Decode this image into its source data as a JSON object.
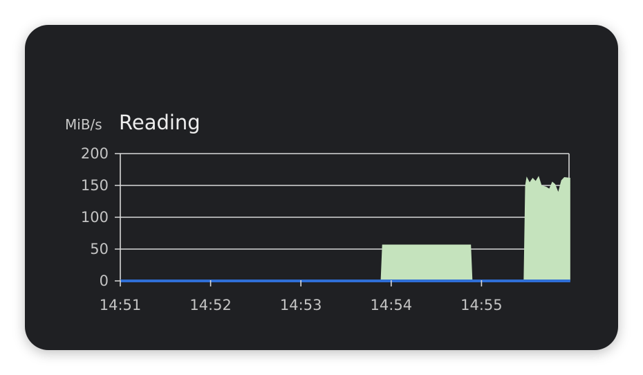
{
  "header": {
    "unit_label": "MiB/s",
    "title": "Reading"
  },
  "colors": {
    "background": "#1f2023",
    "grid": "#d9d9d9",
    "area": "#c5e3bd",
    "baseline": "#2f6fd6",
    "text": "#c4c4c4"
  },
  "chart_data": {
    "type": "area",
    "title": "Reading",
    "ylabel": "MiB/s",
    "ylim": [
      0,
      200
    ],
    "y_ticks": [
      "0",
      "50",
      "100",
      "150",
      "200"
    ],
    "x_ticks": [
      "14:51",
      "14:52",
      "14:53",
      "14:54",
      "14:55"
    ],
    "xlim": [
      "14:51:00",
      "14:55:59"
    ],
    "grid": true,
    "series": [
      {
        "values": [
          {
            "t": "14:51:00",
            "v": 0
          },
          {
            "t": "14:53:53",
            "v": 0
          },
          {
            "t": "14:53:54",
            "v": 57
          },
          {
            "t": "14:54:53",
            "v": 57
          },
          {
            "t": "14:54:54",
            "v": 0
          },
          {
            "t": "14:55:28",
            "v": 0
          },
          {
            "t": "14:55:29",
            "v": 150
          },
          {
            "t": "14:55:30",
            "v": 164
          },
          {
            "t": "14:55:32",
            "v": 155
          },
          {
            "t": "14:55:34",
            "v": 162
          },
          {
            "t": "14:55:36",
            "v": 157
          },
          {
            "t": "14:55:38",
            "v": 165
          },
          {
            "t": "14:55:40",
            "v": 150
          },
          {
            "t": "14:55:43",
            "v": 148
          },
          {
            "t": "14:55:45",
            "v": 145
          },
          {
            "t": "14:55:47",
            "v": 156
          },
          {
            "t": "14:55:49",
            "v": 152
          },
          {
            "t": "14:55:51",
            "v": 140
          },
          {
            "t": "14:55:53",
            "v": 158
          },
          {
            "t": "14:55:55",
            "v": 163
          },
          {
            "t": "14:55:59",
            "v": 162
          }
        ]
      },
      {
        "values": [
          {
            "t": "14:51:00",
            "v": 0
          },
          {
            "t": "14:55:59",
            "v": 0
          }
        ]
      }
    ]
  }
}
